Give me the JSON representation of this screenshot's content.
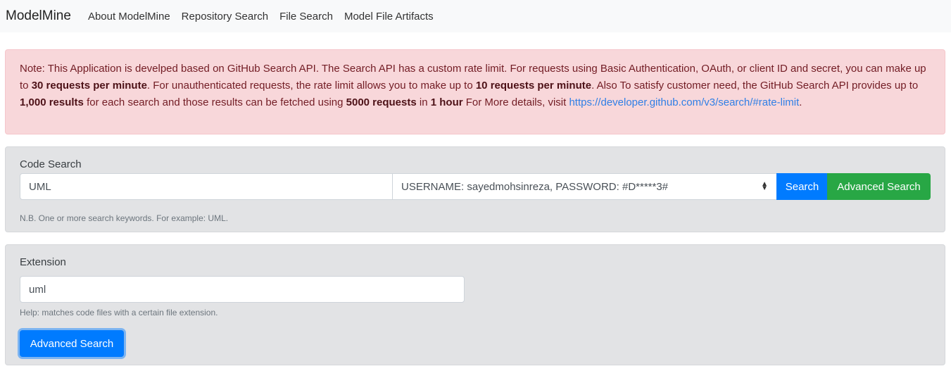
{
  "navbar": {
    "brand": "ModelMine",
    "links": [
      "About ModelMine",
      "Repository Search",
      "File Search",
      "Model File Artifacts"
    ]
  },
  "alert": {
    "t1": "Note: This Application is develped based on GitHub Search API. The Search API has a custom rate limit. For requests using Basic Authentication, OAuth, or client ID and secret, you can make up to ",
    "b1": "30 requests per minute",
    "t2": ". For unauthenticated requests, the rate limit allows you to make up to ",
    "b2": "10 requests per minute",
    "t3": ". Also To satisfy customer need, the GitHub Search API provides up to ",
    "b3": "1,000 results",
    "t4": " for each search and those results can be fetched using ",
    "b4": "5000 requests",
    "t5": " in ",
    "b5": "1 hour",
    "t6": " For More details, visit ",
    "link": "https://developer.github.com/v3/search/#rate-limit",
    "t7": "."
  },
  "code_search": {
    "label": "Code Search",
    "input_value": "UML",
    "credential_selected": "USERNAME: sayedmohsinreza, PASSWORD: #D*****3#",
    "search_label": "Search",
    "advanced_label": "Advanced Search",
    "help": "N.B. One or more search keywords. For example: UML."
  },
  "extension": {
    "label": "Extension",
    "input_value": "uml",
    "help": "Help: matches code files with a certain file extension.",
    "advanced_label": "Advanced Search"
  },
  "colors": {
    "primary": "#007bff",
    "success": "#28a745",
    "alert_bg": "#f8d7da",
    "alert_text": "#721c24",
    "card_bg": "#e2e3e5"
  }
}
